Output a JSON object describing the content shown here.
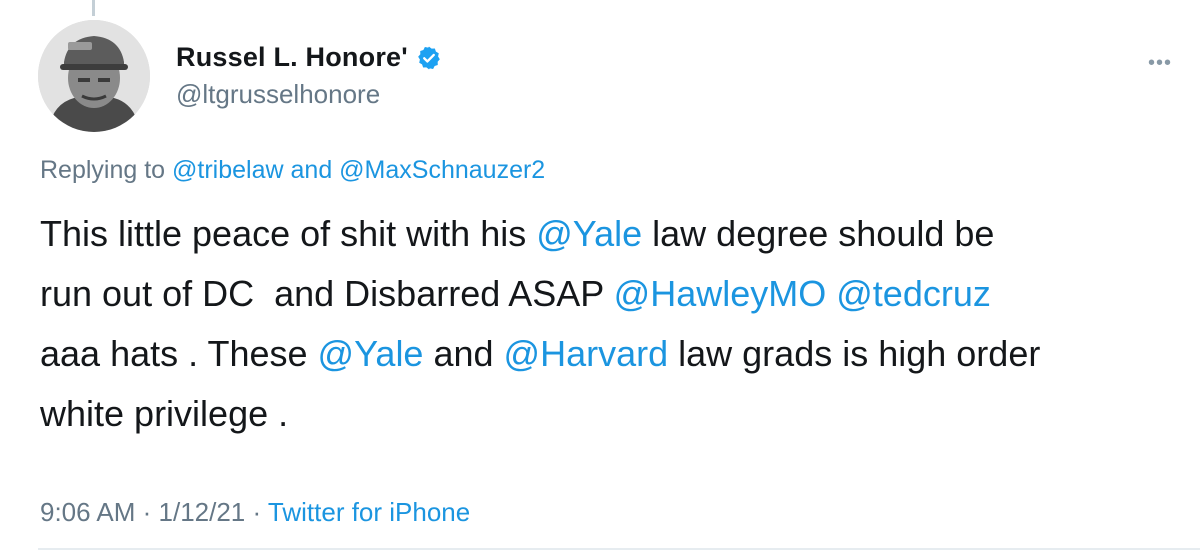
{
  "tweet": {
    "author": {
      "display_name": "Russel L. Honore'",
      "handle": "@ltgrusselhonore",
      "verified_icon": "verified-badge-icon"
    },
    "reply": {
      "prefix": "Replying to ",
      "mention_1": "@tribelaw",
      "conjunction": " and ",
      "mention_2": "@MaxSchnauzer2"
    },
    "body": {
      "t1": "This little peace of shit with his ",
      "m1": "@Yale",
      "t2": " law degree should be\nrun out of DC  and Disbarred ASAP ",
      "m2": "@HawleyMO",
      "t3": " ",
      "m3": "@tedcruz",
      "t4": "\naaa hats . These ",
      "m4": "@Yale",
      "t5": " and ",
      "m5": "@Harvard",
      "t6": " law grads is high order\nwhite privilege ."
    },
    "meta": {
      "time": "9:06 AM",
      "sep1": " · ",
      "date": "1/12/21",
      "sep2": " · ",
      "source": "Twitter for iPhone"
    }
  },
  "colors": {
    "link": "#1b95e0",
    "secondary_text": "#657786",
    "primary_text": "#14171a",
    "verified": "#1da1f2"
  }
}
